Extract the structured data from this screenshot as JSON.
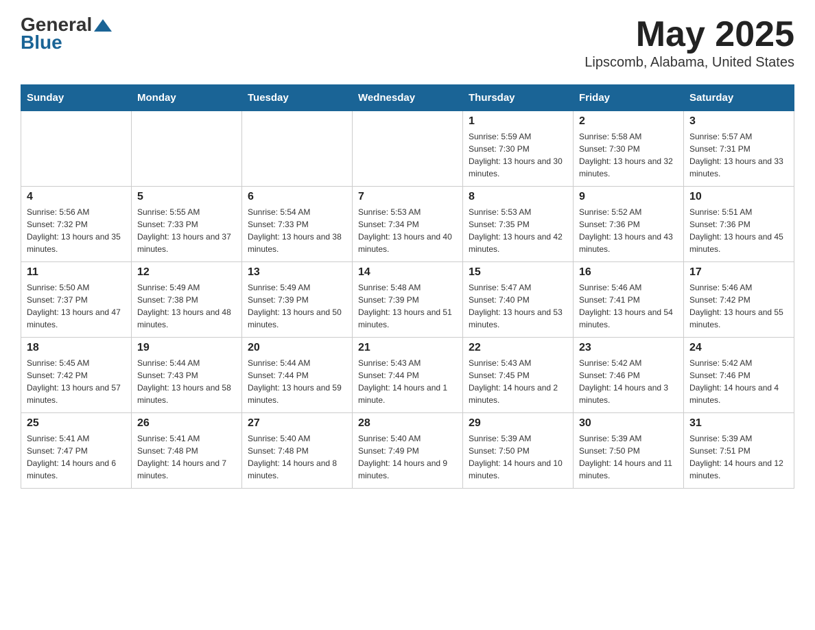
{
  "logo": {
    "general": "General",
    "blue": "Blue"
  },
  "title": "May 2025",
  "subtitle": "Lipscomb, Alabama, United States",
  "days_of_week": [
    "Sunday",
    "Monday",
    "Tuesday",
    "Wednesday",
    "Thursday",
    "Friday",
    "Saturday"
  ],
  "weeks": [
    [
      {
        "day": "",
        "info": ""
      },
      {
        "day": "",
        "info": ""
      },
      {
        "day": "",
        "info": ""
      },
      {
        "day": "",
        "info": ""
      },
      {
        "day": "1",
        "info": "Sunrise: 5:59 AM\nSunset: 7:30 PM\nDaylight: 13 hours and 30 minutes."
      },
      {
        "day": "2",
        "info": "Sunrise: 5:58 AM\nSunset: 7:30 PM\nDaylight: 13 hours and 32 minutes."
      },
      {
        "day": "3",
        "info": "Sunrise: 5:57 AM\nSunset: 7:31 PM\nDaylight: 13 hours and 33 minutes."
      }
    ],
    [
      {
        "day": "4",
        "info": "Sunrise: 5:56 AM\nSunset: 7:32 PM\nDaylight: 13 hours and 35 minutes."
      },
      {
        "day": "5",
        "info": "Sunrise: 5:55 AM\nSunset: 7:33 PM\nDaylight: 13 hours and 37 minutes."
      },
      {
        "day": "6",
        "info": "Sunrise: 5:54 AM\nSunset: 7:33 PM\nDaylight: 13 hours and 38 minutes."
      },
      {
        "day": "7",
        "info": "Sunrise: 5:53 AM\nSunset: 7:34 PM\nDaylight: 13 hours and 40 minutes."
      },
      {
        "day": "8",
        "info": "Sunrise: 5:53 AM\nSunset: 7:35 PM\nDaylight: 13 hours and 42 minutes."
      },
      {
        "day": "9",
        "info": "Sunrise: 5:52 AM\nSunset: 7:36 PM\nDaylight: 13 hours and 43 minutes."
      },
      {
        "day": "10",
        "info": "Sunrise: 5:51 AM\nSunset: 7:36 PM\nDaylight: 13 hours and 45 minutes."
      }
    ],
    [
      {
        "day": "11",
        "info": "Sunrise: 5:50 AM\nSunset: 7:37 PM\nDaylight: 13 hours and 47 minutes."
      },
      {
        "day": "12",
        "info": "Sunrise: 5:49 AM\nSunset: 7:38 PM\nDaylight: 13 hours and 48 minutes."
      },
      {
        "day": "13",
        "info": "Sunrise: 5:49 AM\nSunset: 7:39 PM\nDaylight: 13 hours and 50 minutes."
      },
      {
        "day": "14",
        "info": "Sunrise: 5:48 AM\nSunset: 7:39 PM\nDaylight: 13 hours and 51 minutes."
      },
      {
        "day": "15",
        "info": "Sunrise: 5:47 AM\nSunset: 7:40 PM\nDaylight: 13 hours and 53 minutes."
      },
      {
        "day": "16",
        "info": "Sunrise: 5:46 AM\nSunset: 7:41 PM\nDaylight: 13 hours and 54 minutes."
      },
      {
        "day": "17",
        "info": "Sunrise: 5:46 AM\nSunset: 7:42 PM\nDaylight: 13 hours and 55 minutes."
      }
    ],
    [
      {
        "day": "18",
        "info": "Sunrise: 5:45 AM\nSunset: 7:42 PM\nDaylight: 13 hours and 57 minutes."
      },
      {
        "day": "19",
        "info": "Sunrise: 5:44 AM\nSunset: 7:43 PM\nDaylight: 13 hours and 58 minutes."
      },
      {
        "day": "20",
        "info": "Sunrise: 5:44 AM\nSunset: 7:44 PM\nDaylight: 13 hours and 59 minutes."
      },
      {
        "day": "21",
        "info": "Sunrise: 5:43 AM\nSunset: 7:44 PM\nDaylight: 14 hours and 1 minute."
      },
      {
        "day": "22",
        "info": "Sunrise: 5:43 AM\nSunset: 7:45 PM\nDaylight: 14 hours and 2 minutes."
      },
      {
        "day": "23",
        "info": "Sunrise: 5:42 AM\nSunset: 7:46 PM\nDaylight: 14 hours and 3 minutes."
      },
      {
        "day": "24",
        "info": "Sunrise: 5:42 AM\nSunset: 7:46 PM\nDaylight: 14 hours and 4 minutes."
      }
    ],
    [
      {
        "day": "25",
        "info": "Sunrise: 5:41 AM\nSunset: 7:47 PM\nDaylight: 14 hours and 6 minutes."
      },
      {
        "day": "26",
        "info": "Sunrise: 5:41 AM\nSunset: 7:48 PM\nDaylight: 14 hours and 7 minutes."
      },
      {
        "day": "27",
        "info": "Sunrise: 5:40 AM\nSunset: 7:48 PM\nDaylight: 14 hours and 8 minutes."
      },
      {
        "day": "28",
        "info": "Sunrise: 5:40 AM\nSunset: 7:49 PM\nDaylight: 14 hours and 9 minutes."
      },
      {
        "day": "29",
        "info": "Sunrise: 5:39 AM\nSunset: 7:50 PM\nDaylight: 14 hours and 10 minutes."
      },
      {
        "day": "30",
        "info": "Sunrise: 5:39 AM\nSunset: 7:50 PM\nDaylight: 14 hours and 11 minutes."
      },
      {
        "day": "31",
        "info": "Sunrise: 5:39 AM\nSunset: 7:51 PM\nDaylight: 14 hours and 12 minutes."
      }
    ]
  ]
}
